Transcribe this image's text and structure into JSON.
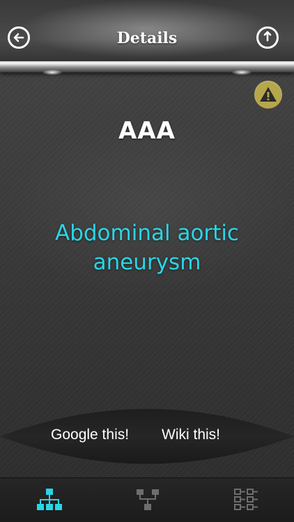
{
  "header": {
    "title": "Details"
  },
  "content": {
    "abbreviation": "AAA",
    "expansion": "Abdominal aortic aneurysm"
  },
  "links": {
    "google_label": "Google this!",
    "wiki_label": "Wiki this!"
  },
  "icons": {
    "back": "back-arrow-icon",
    "share": "share-icon",
    "warning": "warning-icon",
    "tab_1": "hierarchy-icon",
    "tab_2": "tree-icon",
    "tab_3": "checklist-icon"
  },
  "colors": {
    "accent": "#2ad5e6",
    "warning": "#b6a64c",
    "tab_active": "#2ad5e6",
    "tab_inactive": "#6e6e6e"
  }
}
